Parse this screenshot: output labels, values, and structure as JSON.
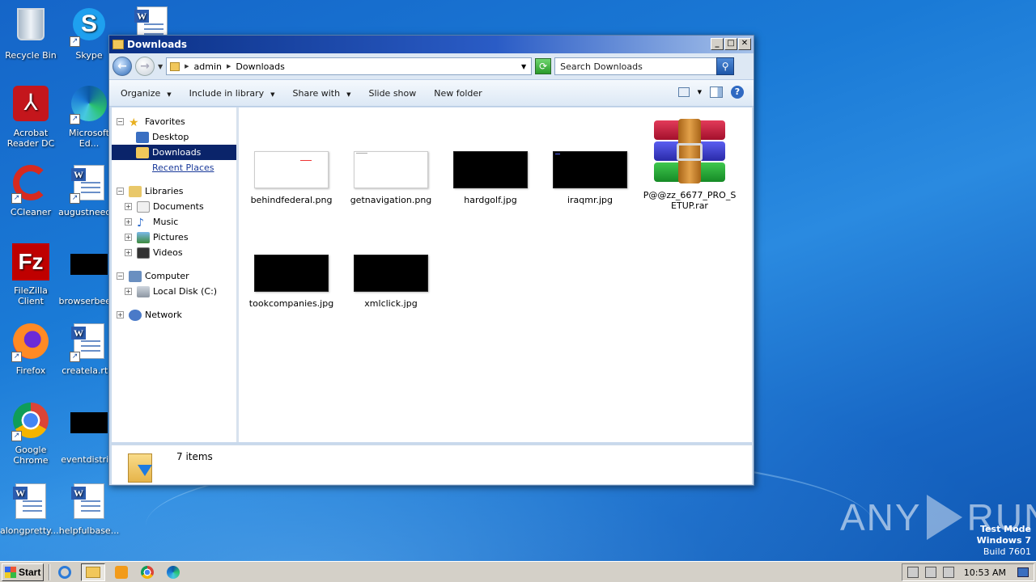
{
  "desktop": {
    "icons": [
      {
        "label": "Recycle Bin"
      },
      {
        "label": "Skype"
      },
      {
        "label": "Acrobat Reader DC"
      },
      {
        "label": "Microsoft Ed..."
      },
      {
        "label": "CCleaner"
      },
      {
        "label": "augustneed..."
      },
      {
        "label": "FileZilla Client"
      },
      {
        "label": "browserbee..."
      },
      {
        "label": "Firefox"
      },
      {
        "label": "createla.rt..."
      },
      {
        "label": "Google Chrome"
      },
      {
        "label": "eventdistri..."
      },
      {
        "label": "alongpretty...."
      },
      {
        "label": "helpfulbase..."
      }
    ]
  },
  "window": {
    "title": "Downloads",
    "buttons": {
      "minimize": "_",
      "maximize": "□",
      "close": "✕"
    },
    "address": {
      "crumbs": [
        "admin",
        "Downloads"
      ]
    },
    "search": {
      "placeholder": "Search Downloads"
    },
    "toolbar": {
      "organize": "Organize",
      "include_in_library": "Include in library",
      "share_with": "Share with",
      "slide_show": "Slide show",
      "new_folder": "New folder"
    },
    "nav": {
      "favorites": "Favorites",
      "desktop": "Desktop",
      "downloads": "Downloads",
      "recent_places": "Recent Places",
      "libraries": "Libraries",
      "documents": "Documents",
      "music": "Music",
      "pictures": "Pictures",
      "videos": "Videos",
      "computer": "Computer",
      "local_disk": "Local Disk (C:)",
      "network": "Network"
    },
    "files": [
      {
        "name": "behindfederal.png",
        "thumb": "white"
      },
      {
        "name": "getnavigation.png",
        "thumb": "white"
      },
      {
        "name": "hardgolf.jpg",
        "thumb": "black"
      },
      {
        "name": "iraqmr.jpg",
        "thumb": "black"
      },
      {
        "name": "P@@zz_6677_PRO_SETUP.rar",
        "thumb": "rar"
      },
      {
        "name": "tookcompanies.jpg",
        "thumb": "black"
      },
      {
        "name": "xmlclick.jpg",
        "thumb": "black"
      }
    ],
    "status": {
      "item_count": "7 items"
    }
  },
  "watermark": {
    "left": "ANY",
    "right": "RUN"
  },
  "testmode": {
    "line1": "Test Mode",
    "line2": "Windows 7",
    "line3": "Build 7601"
  },
  "taskbar": {
    "start_label": "Start",
    "clock": "10:53 AM"
  },
  "colors": {
    "title_start": "#0a2f84",
    "selection": "#0a246a",
    "desktop": "#1a7ad6"
  }
}
